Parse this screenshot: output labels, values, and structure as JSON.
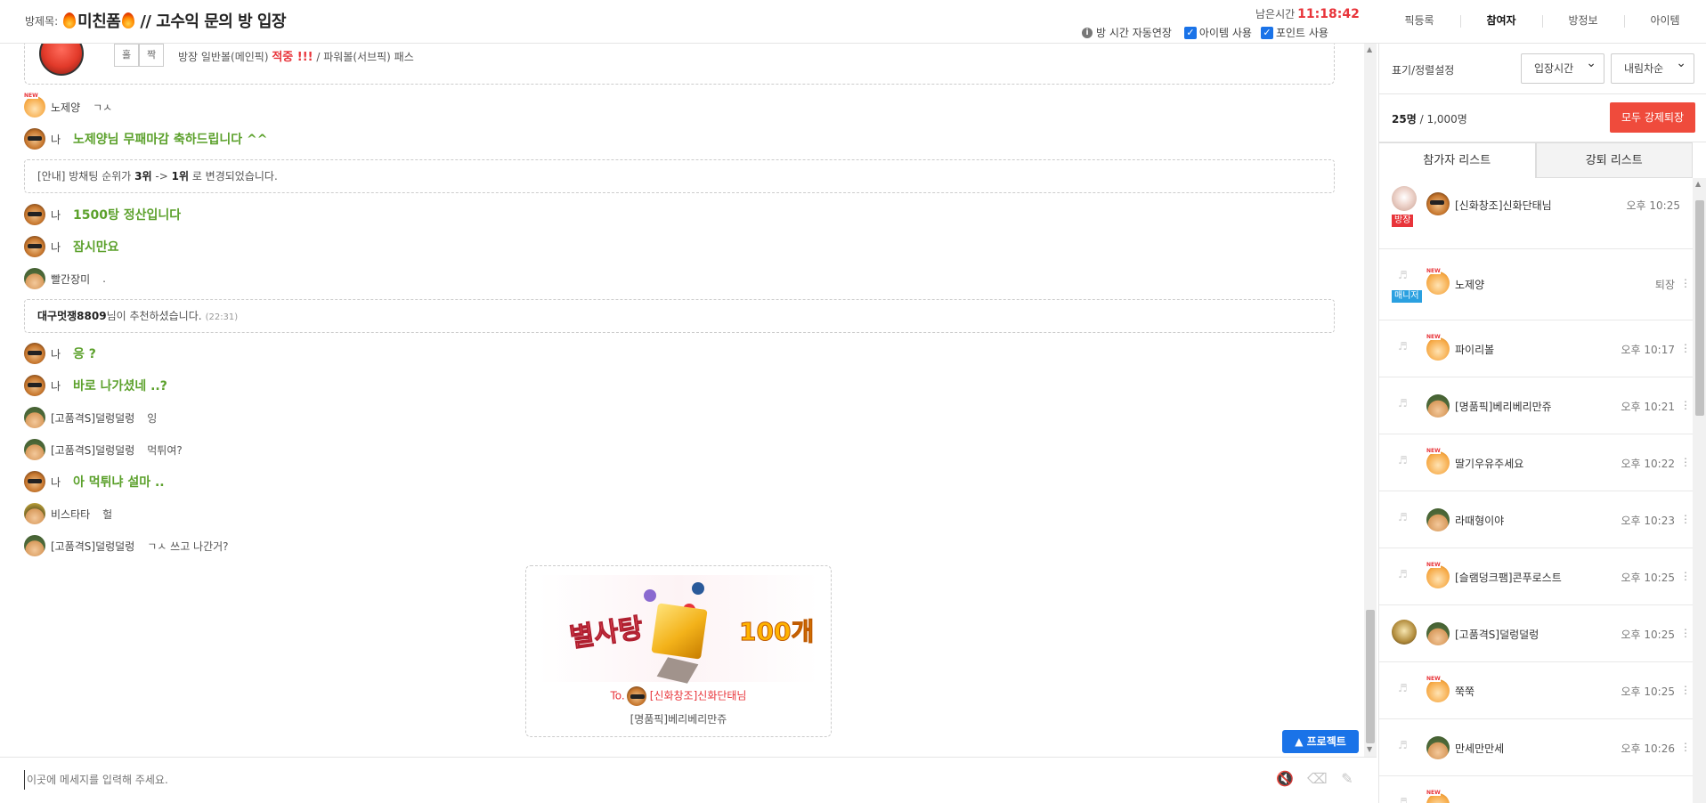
{
  "header": {
    "title_prefix": "방제목:",
    "title": "미친폼",
    "title_suffix": "// 고수익 문의 방 입장",
    "remain_label": "남은시간",
    "remain_time": "11:18:42",
    "auto_extend_label": "방 시간 자동연장",
    "item_use_label": "아이템 사용",
    "point_use_label": "포인트 사용"
  },
  "topnav": [
    "픽등록",
    "참여자",
    "방정보",
    "아이템"
  ],
  "topnav_active": "참여자",
  "banner": {
    "btn_hol": "홀",
    "btn_jjak": "짝",
    "text_a": "방장 일반볼(메인픽)",
    "text_hit": "적중 !!!",
    "text_b": "/ 파워볼(서브픽) 패스"
  },
  "chat": {
    "m1_name": "노제양",
    "m1_text": "ㄱㅅ",
    "m2_name": "나",
    "m2_text": "노제양님 무패마감 축하드립니다 ^^",
    "n1_a": "[안내] 방채팅 순위가",
    "n1_b": "3위",
    "n1_c": "->",
    "n1_d": "1위",
    "n1_e": "로 변경되었습니다.",
    "m3_name": "나",
    "m3_text": "1500탕 정산입니다",
    "m4_name": "나",
    "m4_text": "잠시만요",
    "m5_name": "빨간장미",
    "m5_text": ".",
    "n2_user": "대구멋쟁8809",
    "n2_text": "님이 추천하셨습니다.",
    "n2_time": "(22:31)",
    "m6_name": "나",
    "m6_text": "응 ?",
    "m7_name": "나",
    "m7_text": "바로 나가셨네 ..?",
    "m8_name": "[고품격S]덜렁덜렁",
    "m8_text": "잉",
    "m9_name": "[고품격S]덜렁덜렁",
    "m9_text": "먹튀여?",
    "m10_name": "나",
    "m10_text": "아 먹튀냐 설마 ..",
    "m11_name": "비스타타",
    "m11_text": "헐",
    "m12_name": "[고품격S]덜렁덜렁",
    "m12_text": "ㄱㅅ 쓰고 나간거?"
  },
  "gift": {
    "title_text": "별사탕",
    "count_text": "100개",
    "to_label": "To.",
    "to_user": "[신화창조]신화단태님",
    "from_user": "[명품픽]베리베리만쥬"
  },
  "protect_label": "▲ 프로젝트",
  "input": {
    "placeholder": "이곳에 메세지를 입력해 주세요."
  },
  "panel": {
    "sort_label": "표기/정렬설정",
    "sort_select": "입장시간",
    "order_select": "내림차순",
    "count_current": "25명",
    "count_sep": "/",
    "count_max": "1,000명",
    "kick_all_label": "모두 강제퇴장",
    "tab_participants": "참가자 리스트",
    "tab_kicked": "강퇴 리스트",
    "participants": [
      {
        "name": "[신화창조]신화단태님",
        "time": "오후 10:25",
        "badge": "방장"
      },
      {
        "name": "노제양",
        "time": "퇴장",
        "badge": "매니저"
      },
      {
        "name": "파이리볼",
        "time": "오후 10:17"
      },
      {
        "name": "[명품픽]베리베리만쥬",
        "time": "오후 10:21"
      },
      {
        "name": "딸기우유주세요",
        "time": "오후 10:22"
      },
      {
        "name": "라때형이야",
        "time": "오후 10:23"
      },
      {
        "name": "[슬램덩크팸]콘푸로스트",
        "time": "오후 10:25"
      },
      {
        "name": "[고품격S]덜렁덜렁",
        "time": "오후 10:25"
      },
      {
        "name": "쭉쭉",
        "time": "오후 10:25"
      },
      {
        "name": "만세만만세",
        "time": "오후 10:26"
      }
    ]
  },
  "colors": {
    "accent_blue": "#1a73e8",
    "remain_red": "#e8343a",
    "my_text_green": "#5ca12c",
    "kick_red": "#ef4b3c"
  }
}
